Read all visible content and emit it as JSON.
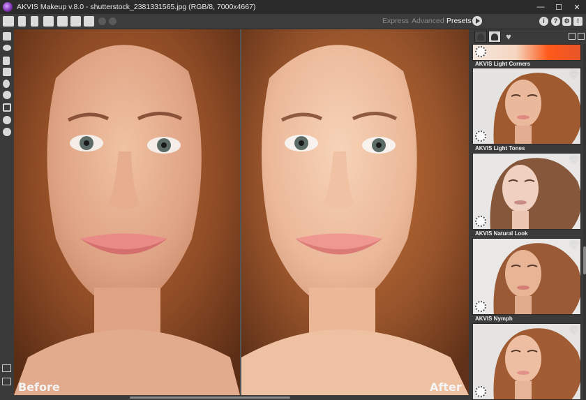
{
  "window": {
    "title": "AKVIS Makeup v.8.0 - shutterstock_2381331565.jpg (RGB/8, 7000x4667)",
    "minimize": "—",
    "maximize": "☐",
    "close": "✕"
  },
  "toolbar": {
    "icons": [
      "home-icon",
      "open-icon",
      "save-icon",
      "print-icon",
      "share-icon",
      "batch-icon",
      "settings-icon",
      "undo-icon",
      "redo-icon"
    ],
    "tabs": [
      {
        "label": "Express",
        "active": false
      },
      {
        "label": "Advanced",
        "active": false
      },
      {
        "label": "Presets",
        "active": true
      }
    ],
    "right_icons": [
      "info-icon",
      "help-icon",
      "gear-icon",
      "feedback-icon"
    ]
  },
  "tools": [
    "eraser-icon",
    "eye-icon",
    "brush-icon",
    "stamp-icon",
    "drop-icon",
    "blend-icon",
    "crop-icon",
    "hand-icon",
    "zoom-icon"
  ],
  "panels": {
    "before_label": "Before",
    "after_label": "After"
  },
  "presets": {
    "tabs": [
      "preset-category-icon",
      "portrait-icon",
      "favorites-icon"
    ],
    "items": [
      {
        "name": "AKVIS Light Corners"
      },
      {
        "name": "AKVIS Light Tones"
      },
      {
        "name": "AKVIS Natural Look"
      },
      {
        "name": "AKVIS Nymph"
      }
    ]
  },
  "colors": {
    "background": "#3a3a3a",
    "titlebar": "#2b2b2b",
    "hair": "#a5592c",
    "skin": "#e9b595",
    "lips": "#e58986"
  }
}
